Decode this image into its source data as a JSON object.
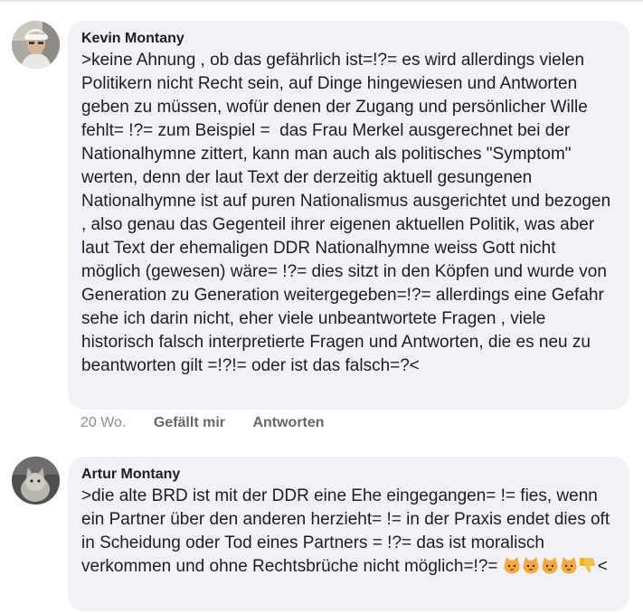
{
  "comments": [
    {
      "author": "Kevin Montany",
      "text": ">keine Ahnung , ob das gefährlich ist=!?= es wird allerdings vielen Politikern nicht Recht sein, auf Dinge hingewiesen und Antworten geben zu müssen, wofür denen der Zugang und persönlicher Wille  fehlt= !?= zum Beispiel =  das Frau Merkel ausgerechnet bei der Nationalhymne zittert, kann man auch als politisches \"Symptom\" werten, denn der laut Text der derzeitig aktuell gesungenen Nationalhymne ist auf puren Nationalismus ausgerichtet und bezogen  , also genau das Gegenteil ihrer eigenen aktuellen Politik, was aber laut Text der ehemaligen DDR Nationalhymne weiss Gott nicht möglich (gewesen) wäre= !?= dies sitzt in den Köpfen und wurde von Generation zu Generation weitergegeben=!?= allerdings eine Gefahr sehe ich darin nicht, eher viele unbeantwortete Fragen , viele historisch falsch interpretierte Fragen und Antworten, die es neu zu beantworten gilt =!?!= oder ist das falsch=?<",
      "time": "20 Wo.",
      "like_label": "Gefällt mir",
      "reply_label": "Antworten"
    },
    {
      "author": "Artur Montany",
      "text": ">die alte BRD ist mit der DDR eine Ehe eingegangen= != fies, wenn ein Partner über den anderen herzieht= != in der Praxis endet dies oft in Scheidung oder Tod eines Partners = !?= das ist moralisch verkommen und ohne Rechtsbrüche nicht möglich=!?= ",
      "text_end": "<",
      "emojis": [
        "cat-face-icon",
        "cat-face-icon",
        "cat-face-icon",
        "cat-face-icon",
        "thumbs-down-icon"
      ]
    }
  ]
}
